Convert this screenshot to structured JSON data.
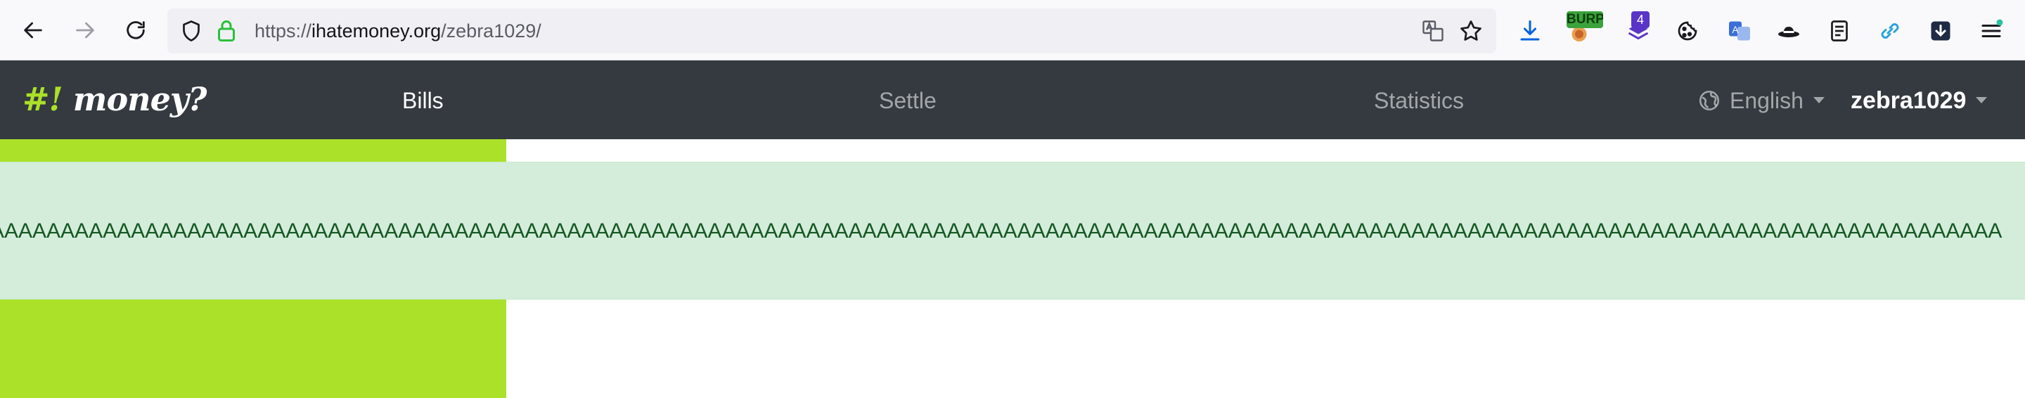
{
  "browser": {
    "url_prefix": "https://",
    "url_domain": "ihatemoney.org",
    "url_path": "/zebra1029/",
    "extension_badge_burp": "BURP",
    "extension_badge_count": "4"
  },
  "app": {
    "brand_hash": "#!",
    "brand_word": " money?",
    "nav": {
      "bills": "Bills",
      "settle": "Settle",
      "statistics": "Statistics"
    },
    "language": "English",
    "user": "zebra1029",
    "accent_color": "#abe128",
    "navbar_color": "#343a40"
  },
  "alert": {
    "message": "AAAAAAAAAAAAAAAAAAAAAAAAAAAAAAAAAAAAAAAAAAAAAAAAAAAAAAAAAAAAAAAAAAAAAAAAAAAAAAAAAAAAAAAAAAAAAAAAAAAAAAAAAAAAAAAAAAAAAAAAAAAAAAAAAAAAAAAAAAAAAAA",
    "background": "#d4edda",
    "text_color": "#155724"
  }
}
